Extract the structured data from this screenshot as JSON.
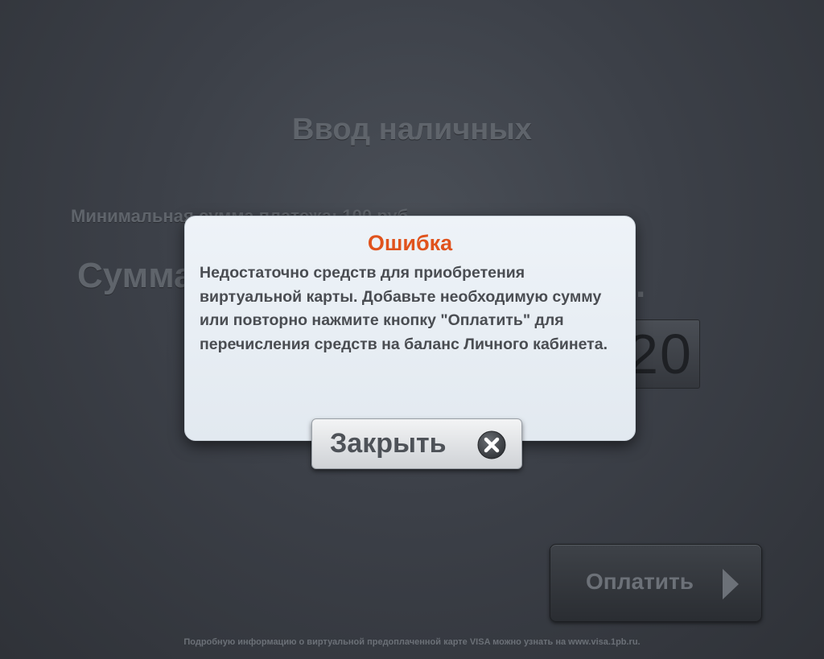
{
  "screen": {
    "title": "Ввод наличных",
    "min_amount_text": "Минимальная сумма платежа: 100 руб.",
    "sum_label": "Сумма: ",
    "sum_suffix": ".",
    "amount_value": "20"
  },
  "dialog": {
    "title": "Ошибка",
    "message": "Недостаточно средств для приобретения виртуальной карты. Добавьте необходимую сумму или повторно нажмите кнопку \"Оплатить\" для перечисления средств на баланс Личного кабинета.",
    "close_label": "Закрыть",
    "close_icon": "close-icon"
  },
  "pay_button": {
    "label": "Оплатить",
    "icon": "play-arrow-icon"
  },
  "footer": {
    "text": "Подробную информацию о виртуальной предоплаченной карте VISA можно узнать на www.visa.1pb.ru."
  },
  "colors": {
    "error_title": "#e0531d",
    "background": "#3c4048"
  }
}
